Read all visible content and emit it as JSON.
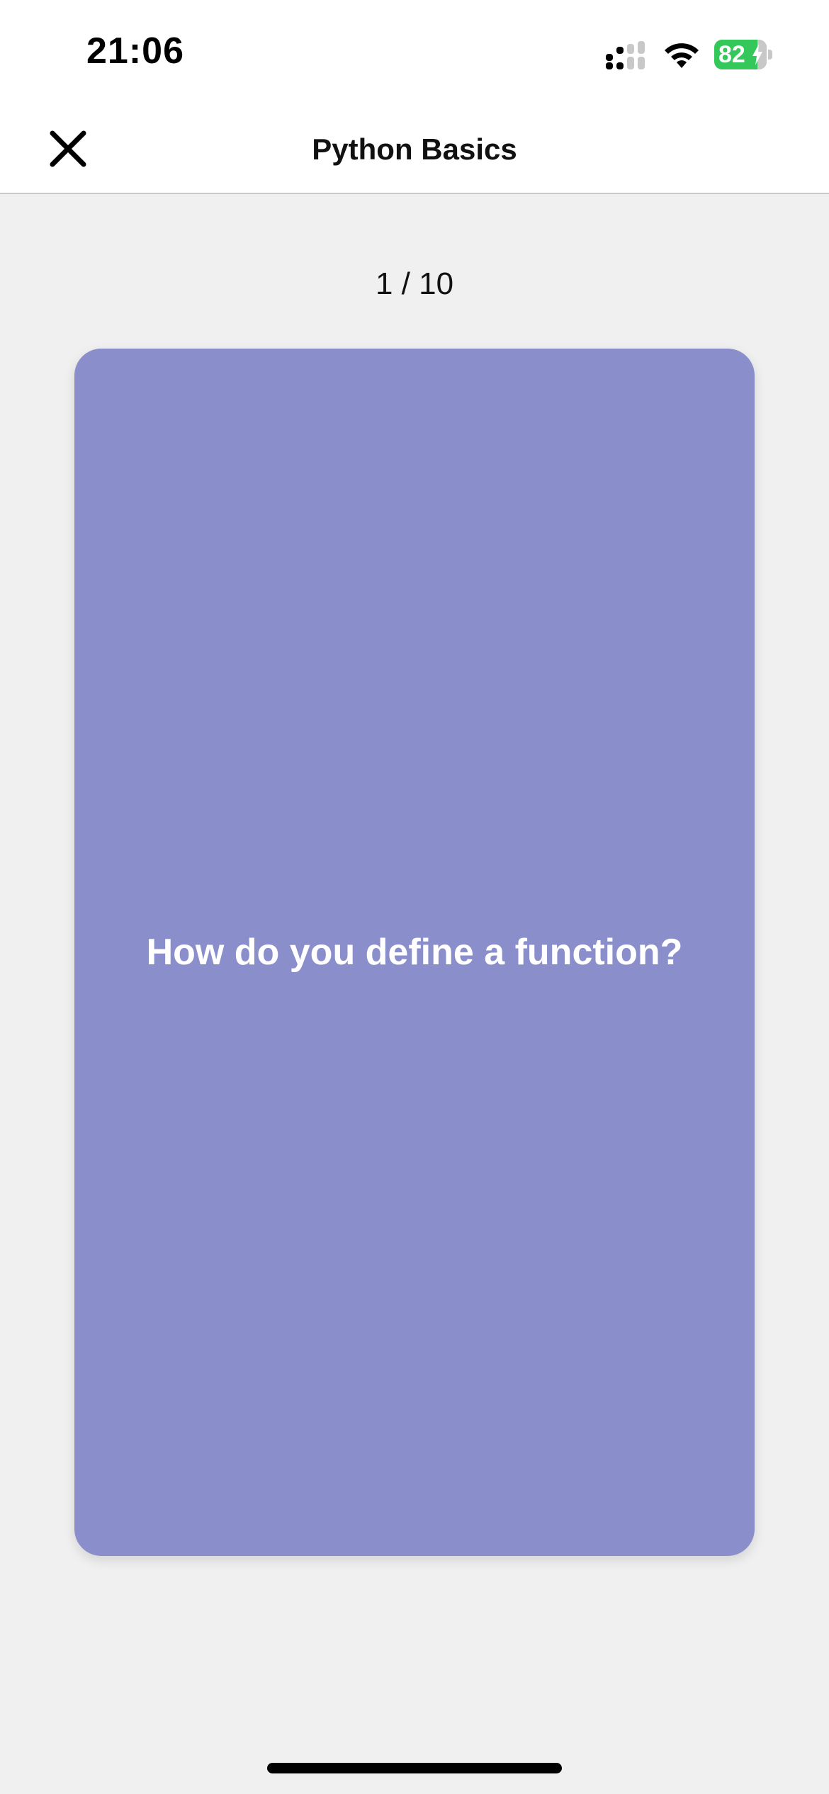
{
  "status_bar": {
    "time": "21:06",
    "battery_level": "82",
    "battery_fraction": 0.82,
    "signal_icon": "cellular-signal-icon",
    "wifi_icon": "wifi-icon",
    "battery_icon": "battery-charging-icon",
    "battery_color": "#34c759"
  },
  "nav": {
    "title": "Python Basics",
    "close_icon": "close-icon"
  },
  "deck": {
    "counter": "1 / 10",
    "current": 1,
    "total": 10
  },
  "card": {
    "question": "How do you define a function?",
    "color": "#8a8fcc"
  }
}
